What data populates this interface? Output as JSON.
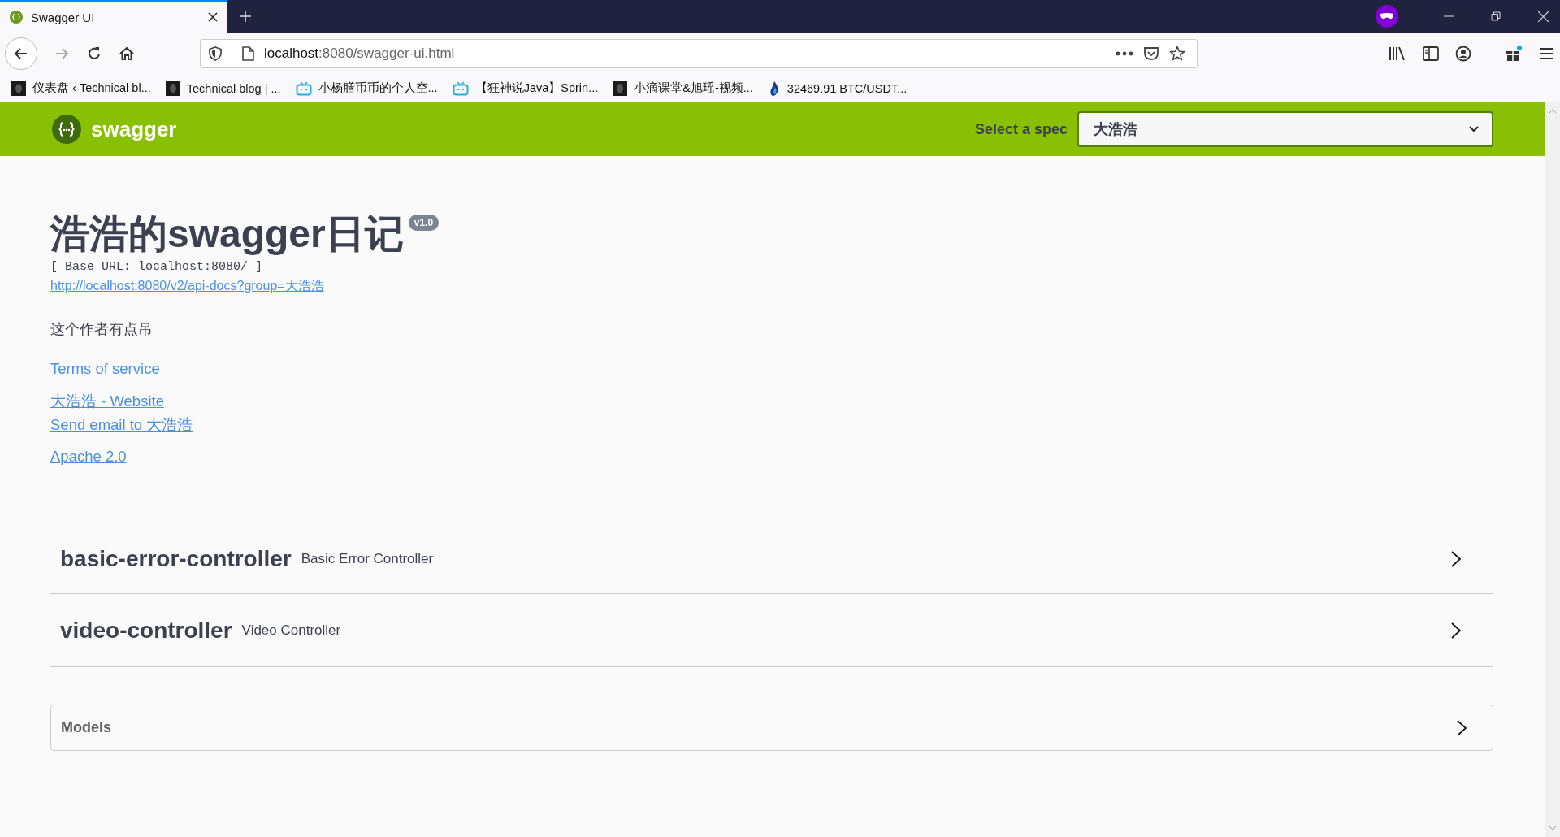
{
  "browser": {
    "tabs": [
      {
        "title": "Swagger UI",
        "selected": true
      }
    ],
    "address": {
      "host": "localhost",
      "path": ":8080/swagger-ui.html"
    },
    "bookmarks": [
      {
        "kind": "dark",
        "label": "仪表盘 ‹ Technical bl..."
      },
      {
        "kind": "dark",
        "label": "Technical blog | ..."
      },
      {
        "kind": "tv",
        "label": "小杨膳币币的个人空..."
      },
      {
        "kind": "tv",
        "label": "【狂神说Java】Sprin..."
      },
      {
        "kind": "dark",
        "label": "小滴课堂&旭瑶-视频..."
      },
      {
        "kind": "flame",
        "label": "32469.91 BTC/USDT..."
      }
    ]
  },
  "header": {
    "logo_text": "swagger",
    "select_label": "Select a spec",
    "select_value": "大浩浩"
  },
  "info": {
    "title": "浩浩的swagger日记",
    "version": "v1.0",
    "base_url": "[ Base URL: localhost:8080/ ]",
    "spec_link": "http://localhost:8080/v2/api-docs?group=大浩浩",
    "description": "这个作者有点吊",
    "link_groups": [
      [
        "Terms of service"
      ],
      [
        "大浩浩 - Website",
        "Send email to 大浩浩"
      ],
      [
        "Apache 2.0"
      ]
    ]
  },
  "tags": [
    {
      "name": "basic-error-controller",
      "description": "Basic Error Controller",
      "expanded": false
    },
    {
      "name": "video-controller",
      "description": "Video Controller",
      "expanded": false
    }
  ],
  "models": {
    "title": "Models",
    "expanded": false
  }
}
